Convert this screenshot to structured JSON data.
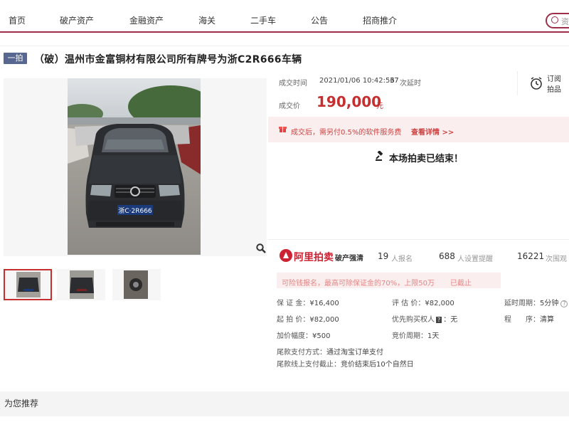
{
  "nav": {
    "items": [
      "首页",
      "破产资产",
      "金融资产",
      "海关",
      "二手车",
      "公告",
      "招商推介"
    ],
    "search_placeholder": "资"
  },
  "title": {
    "badge": "一拍",
    "text": "（破）温州市金富铜材有限公司所有牌号为浙C2R666车辆"
  },
  "vehicle_plate": "浙C·2R666",
  "result": {
    "time_label": "成交时间",
    "time_value": "2021/01/06 10:42:56",
    "delay_count": "37",
    "delay_label": "次延时",
    "price_label": "成交价",
    "price_value": "190,000",
    "price_unit": "元",
    "remind_line1": "订阅",
    "remind_line2": "拍品",
    "fee_text": "成交后，需另付0.5%的软件服务费",
    "fee_link": "查看详情 >>",
    "ended": "本场拍卖已结束！"
  },
  "platform": {
    "logo_text": "阿里拍卖",
    "sub_text": "破产强清",
    "signups_num": "19",
    "signups_label": "人报名",
    "reminders_num": "688",
    "reminders_label": "人设置提醒",
    "views_num": "16221",
    "views_label": "次围观"
  },
  "warning": {
    "text": "可险钱报名，最高可除保证金的70%，上限50万",
    "status": "已截止"
  },
  "details": {
    "deposit_label": "保 证 金：",
    "deposit_value": "¥16,400",
    "appraisal_label": "评 估 价：",
    "appraisal_value": "¥82,000",
    "delay_label": "延时周期：",
    "delay_value": "5分钟",
    "start_label": "起 拍 价：",
    "start_value": "¥82,000",
    "priority_label": "优先购买权人",
    "priority_value": "无",
    "procedure_label": "程　　序：",
    "procedure_value": "清算",
    "increment_label": "加价幅度：",
    "increment_value": "¥500",
    "cycle_label": "竞价周期：",
    "cycle_value": "1天",
    "payment_method_label": "尾款支付方式：",
    "payment_method_value": "通过淘宝订单支付",
    "payment_deadline_label": "尾款线上支付截止：",
    "payment_deadline_value": "竞价结束后10个自然日"
  },
  "recommend": {
    "title": "为您推荐"
  },
  "colors": {
    "brand": "#9b2f4c",
    "price": "#c62f2f",
    "badge": "#58678f"
  }
}
